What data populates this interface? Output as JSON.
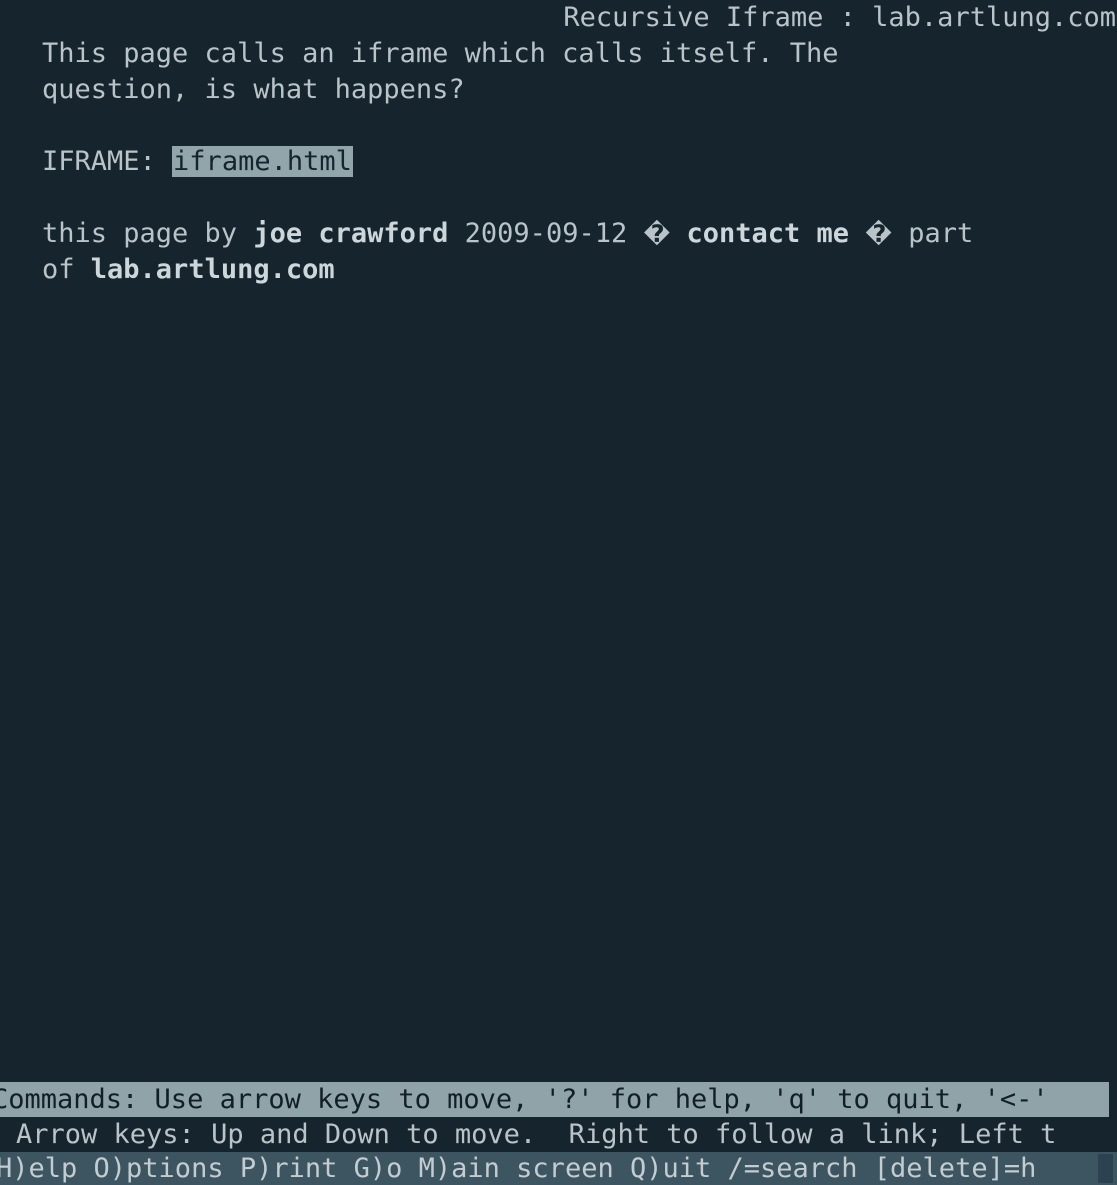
{
  "browser": "lynx",
  "colors": {
    "background": "#16242d",
    "foreground": "#b9c4c9",
    "status_bar_bg": "#8fa3a9",
    "status_bar_fg": "#121f27",
    "key_bar_bg": "#3d5561",
    "key_bar_fg": "#c3ccd0",
    "current_link_bg": "#92a5ab",
    "current_link_fg": "#16242d",
    "cursor_block": "#2d4250"
  },
  "page": {
    "title": "Recursive Iframe : lab.artlung.com",
    "paragraph_line_1": "This page calls an iframe which calls itself. The",
    "paragraph_line_2": "question, is what happens?",
    "iframe_label": "IFRAME: ",
    "iframe_link_text": "iframe.html",
    "byline": {
      "prefix": "this page by ",
      "author": "joe crawford",
      "date": " 2009-09-12 ",
      "separator_1": "�",
      "contact_link": " contact me ",
      "separator_2": "�",
      "middle": " part",
      "second_line_prefix": "of ",
      "site_link": "lab.artlung.com"
    }
  },
  "status": {
    "commands_line": "Commands: Use arrow keys to move, '?' for help, 'q' to quit, '<-'",
    "help_line": "Arrow keys: Up and Down to move.  Right to follow a link; Left t",
    "keys_line": "H)elp O)ptions P)rint G)o M)ain screen Q)uit /=search [delete]=h"
  },
  "key_menu_items": [
    "H)elp",
    "O)ptions",
    "P)rint",
    "G)o",
    "M)ain screen",
    "Q)uit",
    "/=search",
    "[delete]=h"
  ]
}
